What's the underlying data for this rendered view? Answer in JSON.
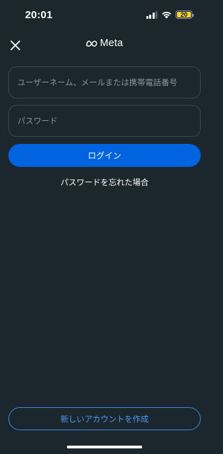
{
  "status_bar": {
    "time": "20:01",
    "battery_level": "20",
    "battery_color": "#f5d33b",
    "icons": [
      "signal-icon",
      "wifi-icon",
      "battery-icon"
    ]
  },
  "header": {
    "close_icon": "close-icon",
    "brand_logo_icon": "meta-logo-icon",
    "brand_name": "Meta"
  },
  "form": {
    "username_placeholder": "ユーザーネーム、メールまたは携帯電話番号",
    "password_placeholder": "パスワード",
    "login_label": "ログイン",
    "forgot_password_label": "パスワードを忘れた場合"
  },
  "footer": {
    "create_account_label": "新しいアカウントを作成"
  },
  "colors": {
    "background": "#1c262d",
    "primary": "#0064e0",
    "outline_accent": "#3b88e6"
  }
}
